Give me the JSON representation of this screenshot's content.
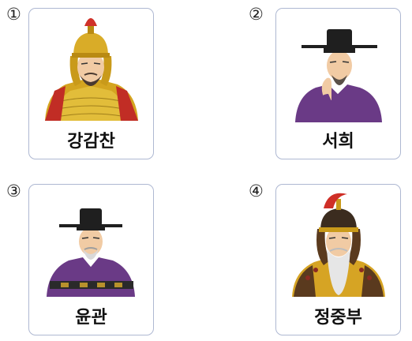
{
  "options": [
    {
      "number": "①",
      "name": "강감찬",
      "portrait": "general-in-golden-armor-with-red-plumed-helmet"
    },
    {
      "number": "②",
      "name": "서희",
      "portrait": "scholar-official-in-purple-robe-and-black-hat"
    },
    {
      "number": "③",
      "name": "윤관",
      "portrait": "official-in-purple-robe-with-black-hat-and-belt"
    },
    {
      "number": "④",
      "name": "정중부",
      "portrait": "elder-general-in-armor-with-white-beard"
    }
  ]
}
